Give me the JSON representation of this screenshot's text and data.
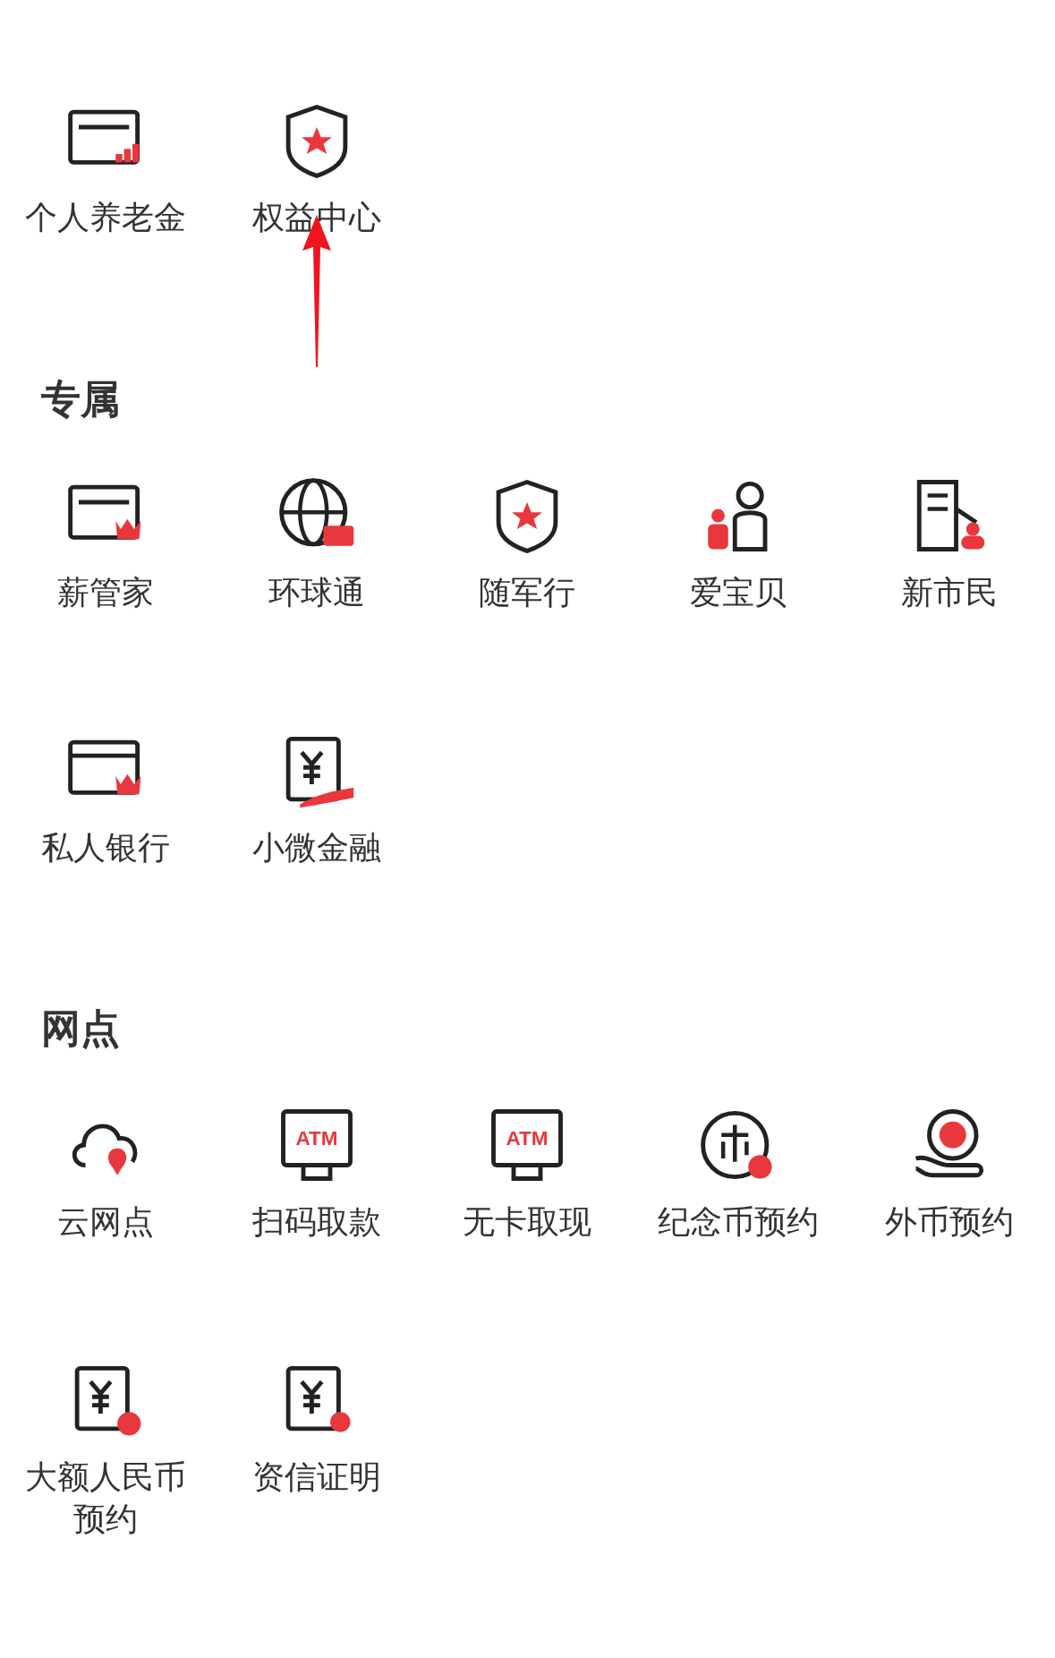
{
  "top_items": [
    {
      "label": "个人养老金",
      "kind": "card-bars"
    },
    {
      "label": "权益中心",
      "kind": "shield-star"
    }
  ],
  "annotation": {
    "kind": "arrow"
  },
  "sections": [
    {
      "title": "专属",
      "items": [
        {
          "label": "薪管家",
          "kind": "card-crown"
        },
        {
          "label": "环球通",
          "kind": "globe"
        },
        {
          "label": "随军行",
          "kind": "shield-star"
        },
        {
          "label": "爱宝贝",
          "kind": "family"
        },
        {
          "label": "新市民",
          "kind": "building-person"
        },
        {
          "label": "私人银行",
          "kind": "bank-card-crown"
        },
        {
          "label": "小微金融",
          "kind": "yuan-hand"
        }
      ]
    },
    {
      "title": "网点",
      "items": [
        {
          "label": "云网点",
          "kind": "cloud-pin"
        },
        {
          "label": "扫码取款",
          "kind": "atm",
          "icon_text": "ATM"
        },
        {
          "label": "无卡取现",
          "kind": "atm",
          "icon_text": "ATM"
        },
        {
          "label": "纪念币预约",
          "kind": "coin-clock"
        },
        {
          "label": "外币预约",
          "kind": "dollar-hand"
        },
        {
          "label": "大额人民币预约",
          "kind": "yuan-clock"
        },
        {
          "label": "资信证明",
          "kind": "yuan-check"
        }
      ]
    }
  ]
}
